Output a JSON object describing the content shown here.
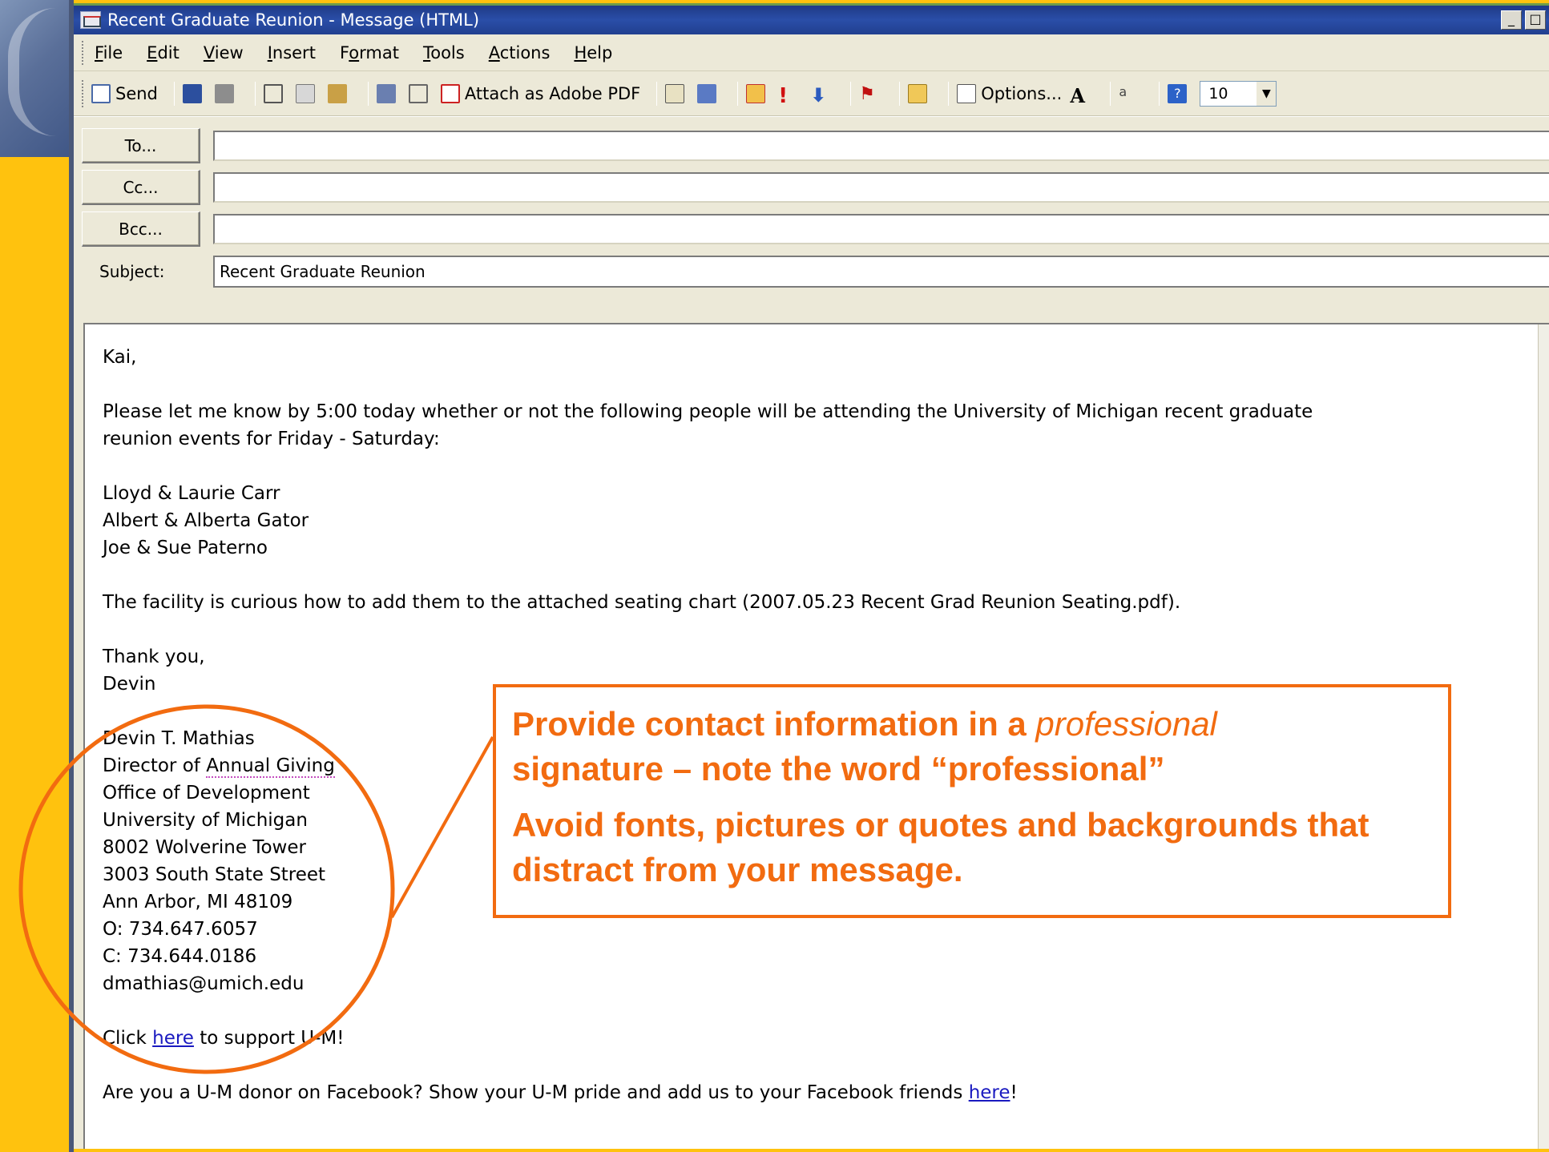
{
  "window": {
    "title": "Recent Graduate Reunion - Message (HTML)",
    "controls": [
      "_",
      "□"
    ]
  },
  "menu": {
    "items": [
      {
        "accel": "F",
        "rest": "ile"
      },
      {
        "accel": "E",
        "rest": "dit"
      },
      {
        "accel": "V",
        "rest": "iew"
      },
      {
        "accel": "I",
        "rest": "nsert"
      },
      {
        "pre": "F",
        "accel": "o",
        "rest": "rmat"
      },
      {
        "accel": "T",
        "rest": "ools"
      },
      {
        "accel": "A",
        "rest": "ctions"
      },
      {
        "accel": "H",
        "rest": "elp"
      }
    ]
  },
  "toolbar": {
    "send_label": "Send",
    "attach_pdf_label": "Attach as Adobe PDF",
    "options_label": "Options...",
    "font_size": "10"
  },
  "header": {
    "to_label": "To...",
    "cc_label": "Cc...",
    "bcc_label": "Bcc...",
    "to_value": "",
    "cc_value": "",
    "bcc_value": "",
    "subject_label": "Subject:",
    "subject_value": "Recent Graduate Reunion"
  },
  "message": {
    "greeting": "Kai,",
    "request_1": "Please let me know by 5:00 today whether or not the following people will be attending the University of Michigan recent graduate",
    "request_2": "reunion events for Friday - Saturday:",
    "attendees": [
      "Lloyd & Laurie Carr",
      "Albert & Alberta Gator",
      "Joe & Sue Paterno"
    ],
    "facility_line": "The facility is curious how to add them to the attached seating chart (2007.05.23 Recent Grad Reunion Seating.pdf).",
    "closing": "Thank you,",
    "sender_first": "Devin",
    "signature": {
      "name": "Devin T. Mathias",
      "title_pre": "Director of ",
      "title_dotted": "Annual Giving",
      "office": "Office of Development",
      "university": "University of Michigan",
      "address_1": "8002 Wolverine Tower",
      "address_2": "3003 South State Street",
      "city": "Ann Arbor, MI 48109",
      "office_phone": "O: 734.647.6057",
      "cell_phone": "C: 734.644.0186",
      "email": "dmathias@umich.edu"
    },
    "support_pre": "Click ",
    "support_link": "here",
    "support_post": " to support U-M!",
    "facebook_pre": "Are you a U-M donor on Facebook?  Show your U-M pride and add us to your Facebook friends ",
    "facebook_link": "here",
    "facebook_post": "!"
  },
  "callout": {
    "line1_pre": "Provide contact information in a ",
    "line1_italic": "professional",
    "line2": "signature – note the word “professional”",
    "line3": "Avoid fonts, pictures or quotes and backgrounds that distract from your message."
  },
  "colors": {
    "slide_background": "#ffc20e",
    "callout_orange": "#f26b10",
    "title_bar": "#2a4ea8"
  }
}
